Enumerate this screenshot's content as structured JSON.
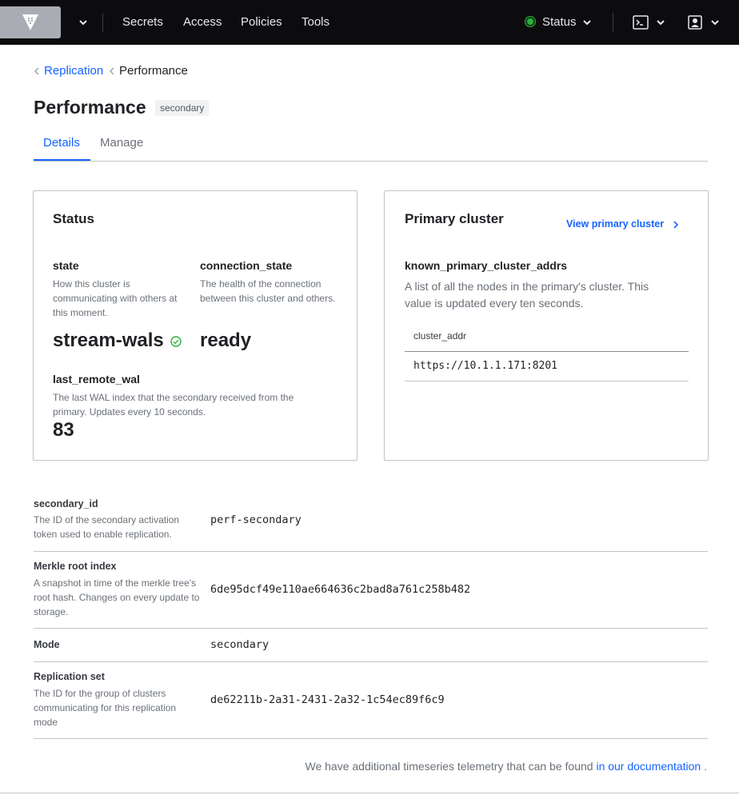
{
  "nav": {
    "links": [
      "Secrets",
      "Access",
      "Policies",
      "Tools"
    ],
    "status_label": "Status"
  },
  "breadcrumb": {
    "parent": "Replication",
    "current": "Performance"
  },
  "page": {
    "title": "Performance",
    "badge": "secondary"
  },
  "tabs": [
    "Details",
    "Manage"
  ],
  "status_card": {
    "title": "Status",
    "state_label": "state",
    "state_help": "How this cluster is communicating with others at this moment.",
    "state_value": "stream-wals",
    "connection_label": "connection_state",
    "connection_help": "The health of the connection between this cluster and others.",
    "connection_value": "ready",
    "wal_label": "last_remote_wal",
    "wal_help": "The last WAL index that the secondary received from the primary. Updates every 10 seconds.",
    "wal_value": "83"
  },
  "primary_card": {
    "title": "Primary cluster",
    "view_link": "View primary cluster",
    "known_label": "known_primary_cluster_addrs",
    "known_help": "A list of all the nodes in the primary's cluster. This value is updated every ten seconds.",
    "table_header": "cluster_addr",
    "table_rows": [
      "https://10.1.1.171:8201"
    ]
  },
  "info": [
    {
      "label": "secondary_id",
      "help": "The ID of the secondary activation token used to enable replication.",
      "value": "perf-secondary"
    },
    {
      "label": "Merkle root index",
      "help": "A snapshot in time of the merkle tree's root hash. Changes on every update to storage.",
      "value": "6de95dcf49e110ae664636c2bad8a761c258b482"
    },
    {
      "label": "Mode",
      "help": "",
      "value": "secondary"
    },
    {
      "label": "Replication set",
      "help": "The ID for the group of clusters communicating for this replication mode",
      "value": "de62211b-2a31-2431-2a32-1c54ec89f6c9"
    }
  ],
  "footer": {
    "text": "We have additional timeseries telemetry that can be found",
    "link": "in our documentation",
    "end": "."
  },
  "colors": {
    "accent": "#1563ff",
    "nav_bg": "#0c0c0e",
    "status_ok": "#2eb039"
  },
  "icons": [
    "vault-logo-icon",
    "chevron-down-icon",
    "status-dot-icon",
    "terminal-icon",
    "user-icon",
    "check-circle-icon",
    "chevron-right-icon",
    "chevron-left-icon"
  ]
}
